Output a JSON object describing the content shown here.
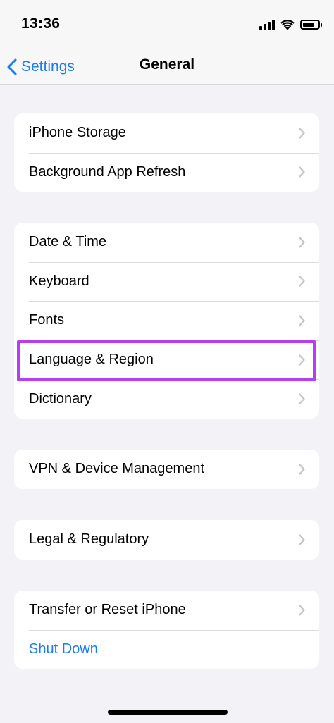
{
  "status_bar": {
    "time": "13:36",
    "battery_level": 0.8
  },
  "nav": {
    "back_label": "Settings",
    "title": "General"
  },
  "groups": [
    {
      "items": [
        {
          "label": "iPhone Storage"
        },
        {
          "label": "Background App Refresh"
        }
      ]
    },
    {
      "items": [
        {
          "label": "Date & Time"
        },
        {
          "label": "Keyboard"
        },
        {
          "label": "Fonts"
        },
        {
          "label": "Language & Region",
          "highlighted": true
        },
        {
          "label": "Dictionary"
        }
      ]
    },
    {
      "items": [
        {
          "label": "VPN & Device Management"
        }
      ]
    },
    {
      "items": [
        {
          "label": "Legal & Regulatory"
        }
      ]
    },
    {
      "items": [
        {
          "label": "Transfer or Reset iPhone"
        },
        {
          "label": "Shut Down",
          "style": "link"
        }
      ]
    }
  ],
  "colors": {
    "accent": "#1a7cf5",
    "highlight": "#b43ef0",
    "background": "#f2f2f7"
  },
  "icons": {
    "back": "chevron-left-icon",
    "row": "chevron-right-icon",
    "wifi": "wifi-icon",
    "signal": "cellular-signal-icon",
    "battery": "battery-icon"
  }
}
